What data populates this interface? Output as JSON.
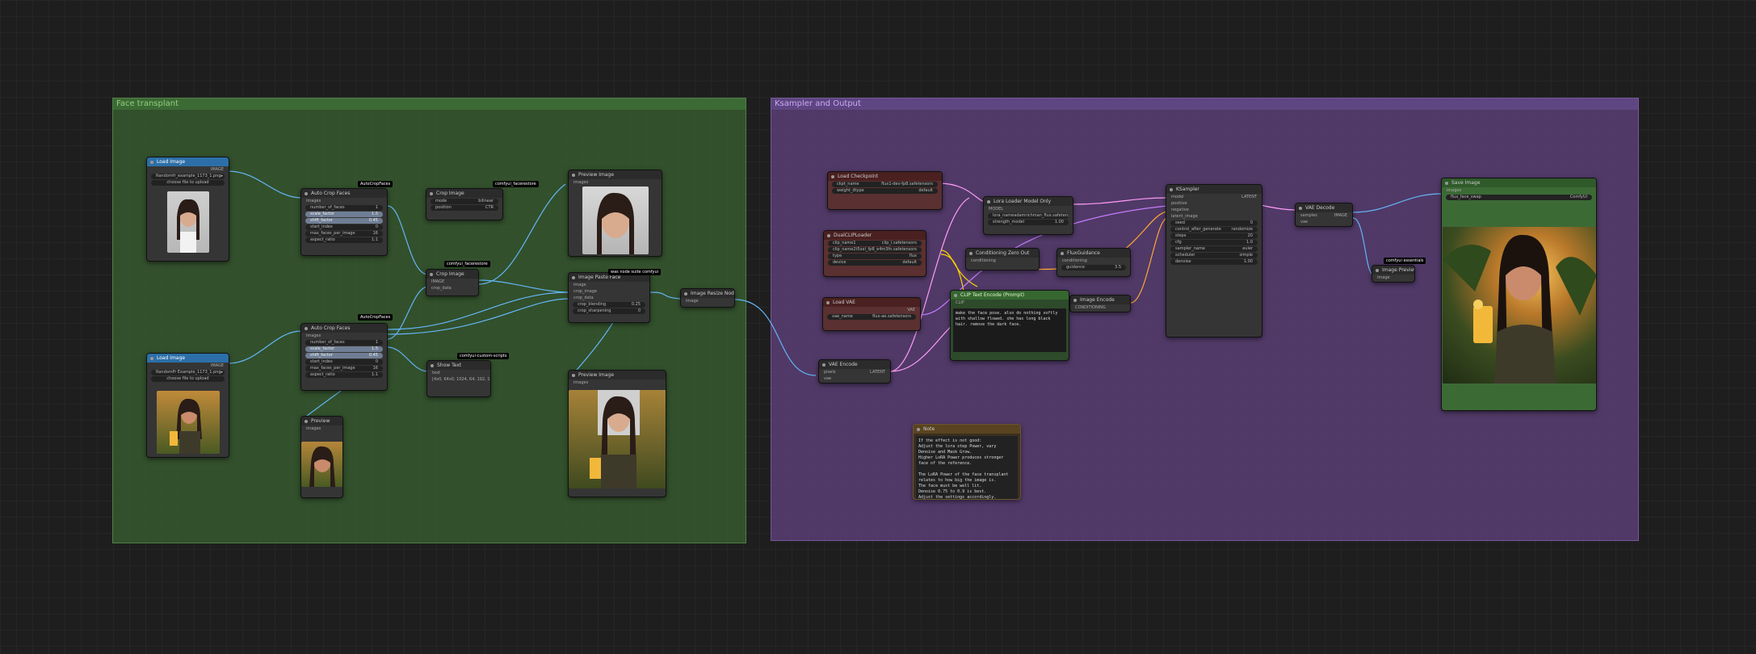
{
  "groups": {
    "face_transplant": "Face transplant",
    "ksampler_output": "Ksampler and Output"
  },
  "nodes": {
    "load_image_1": {
      "title": "Load Image",
      "file": "Randomfr_example_1173_1.png",
      "button": "choose file to upload",
      "caption": ""
    },
    "load_image_2": {
      "title": "Load Image",
      "file": "RandomFr Example_1173_1.png",
      "button": "choose file to upload",
      "caption": ""
    },
    "auto_crop_1": {
      "title": "Auto Crop Faces",
      "badge": "AutoCropFaces"
    },
    "auto_crop_2": {
      "title": "Auto Crop Faces",
      "badge": "AutoCropFaces"
    },
    "crop_node": {
      "title": "Crop Image",
      "badge": "comfyui_facerestore"
    },
    "preview_image_1": {
      "title": "Preview Image",
      "caption": ""
    },
    "preview_image_2": {
      "title": "Preview Image",
      "caption": ""
    },
    "preview_small": {
      "title": "Preview",
      "caption": ""
    },
    "image_paste": {
      "title": "Image Paste Face",
      "badge": "was node suite comfyui"
    },
    "show_text": {
      "title": "Show Text",
      "badge": "comfyui-custom-scripts",
      "text": "[4x0, 64x0, 1024, 64, 192, 1024]"
    },
    "mid_node": {
      "title": "Crop Image",
      "badge": "comfyui_facerestore"
    },
    "realsize": {
      "title": "Image Resize Node",
      "badge": ""
    },
    "vae_encode": {
      "title": "VAE Encode"
    },
    "load_lora": {
      "title": "Load Checkpoint"
    },
    "load_vae": {
      "title": "Load VAE"
    },
    "lora_loader": {
      "title": "Lora Loader Model Only"
    },
    "clip_text": {
      "title": "CLIP Text Encode (Prompt)",
      "text": "make the face pose. also do nothing softly with shallow flowed. she has long black hair. remove the dark face."
    },
    "note": {
      "title": "Note",
      "text": "If the effect is not good:\nAdjust the lora step Power, vary Denoise and Mask Grow.\nHigher LoRA Power produces stronger face of the reference.\n\nThe LoRA Power of the face transplant relates to how big the image is.\nThe face must be well lit.\nDenoise 0.75 to 0.9 is best.\nAdjust the settings accordingly."
    },
    "ksampler": {
      "title": "KSampler"
    },
    "vae_decode": {
      "title": "VAE Decode"
    },
    "save_image": {
      "title": "Save Image",
      "prefix": "flux_face_swap",
      "caption": ""
    },
    "image_preview_small": {
      "title": "Image Preview",
      "badge": "comfyui essentials"
    },
    "flux_guidance": {
      "title": "FluxGuidance",
      "value": "3.5"
    },
    "conditioning": {
      "title": "Conditioning Zero Out"
    },
    "ksampler_params": {
      "seed": "0",
      "control": "randomize",
      "steps": "20",
      "cfg": "1.0",
      "sampler": "euler",
      "scheduler": "simple",
      "denoise": "1.00"
    }
  },
  "labels": {
    "image": "IMAGE",
    "latent": "LATENT",
    "model": "MODEL",
    "clip": "CLIP",
    "vae": "VAE",
    "conditioning": "CONDITIONING",
    "images": "images"
  },
  "colors": {
    "green_group": "#3c6a35",
    "purple_group": "#5e4682",
    "wire_image": "#64b5f6",
    "wire_latent": "#ff9cf9",
    "wire_clip": "#ffd500",
    "wire_cond": "#ffa931"
  }
}
